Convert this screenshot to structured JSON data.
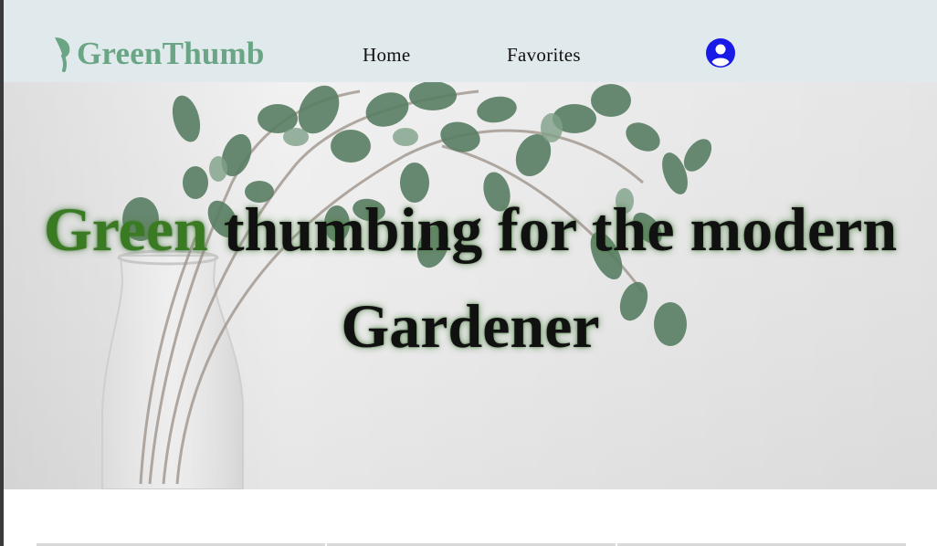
{
  "navbar": {
    "brand": "GreenThumb",
    "brand_color": "#6aa585",
    "background": "#e0e9eb",
    "links": [
      {
        "label": "Home"
      },
      {
        "label": "Favorites"
      }
    ],
    "user_icon": "user-circle-icon",
    "user_icon_color": "#1a1ae6"
  },
  "hero": {
    "accent_word": "Green",
    "accent_color": "#3a7a23",
    "heading_rest": " thumbing for the modern Gardener",
    "background_image": "eucalyptus branches in glass vase"
  },
  "cards": {
    "count": 3
  }
}
